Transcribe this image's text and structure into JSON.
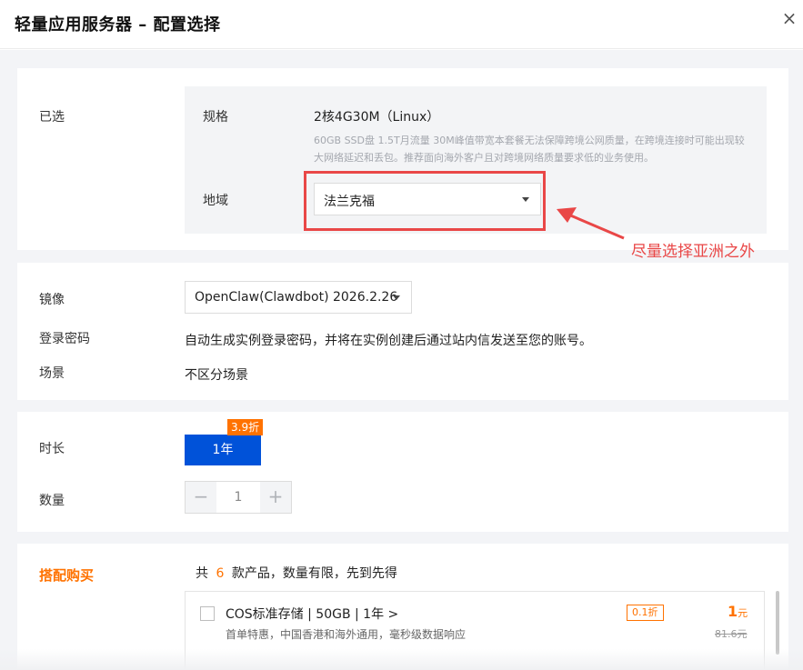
{
  "dialog": {
    "title": "轻量应用服务器 – 配置选择",
    "close_label": "×"
  },
  "selected": {
    "section_label": "已选",
    "spec_label": "规格",
    "spec_value": "2核4G30M（Linux）",
    "spec_desc": "60GB SSD盘 1.5T月流量 30M峰值带宽本套餐无法保障跨境公网质量，在跨境连接时可能出现较大网络延迟和丢包。推荐面向海外客户且对跨境网络质量要求低的业务使用。",
    "region_label": "地域",
    "region_value": "法兰克福"
  },
  "annotation": {
    "text": "尽量选择亚洲之外",
    "color": "#e94747"
  },
  "image": {
    "mirror_label": "镜像",
    "mirror_value": "OpenClaw(Clawdbot) 2026.2.26",
    "password_label": "登录密码",
    "password_value": "自动生成实例登录密码，并将在实例创建后通过站内信发送至您的账号。",
    "scene_label": "场景",
    "scene_value": "不区分场景"
  },
  "duration": {
    "label": "时长",
    "selected_option": "1年",
    "discount_badge": "3.9折",
    "quantity_label": "数量",
    "minus": "−",
    "plus": "+",
    "quantity_value": "1"
  },
  "addons": {
    "title": "搭配购买",
    "summary_prefix": "共",
    "count": "6",
    "summary_suffix": "款产品，数量有限，先到先得",
    "product": {
      "name": "COS标准存储 | 50GB | 1年 >",
      "desc": "首单特惠，中国香港和海外通用，毫秒级数据响应",
      "discount": "0.1折",
      "price": "1",
      "price_unit": "元",
      "orig_price": "81.6元"
    }
  },
  "colors": {
    "primary": "#0052d9",
    "accent": "#ff7200",
    "highlight": "#e94747"
  }
}
